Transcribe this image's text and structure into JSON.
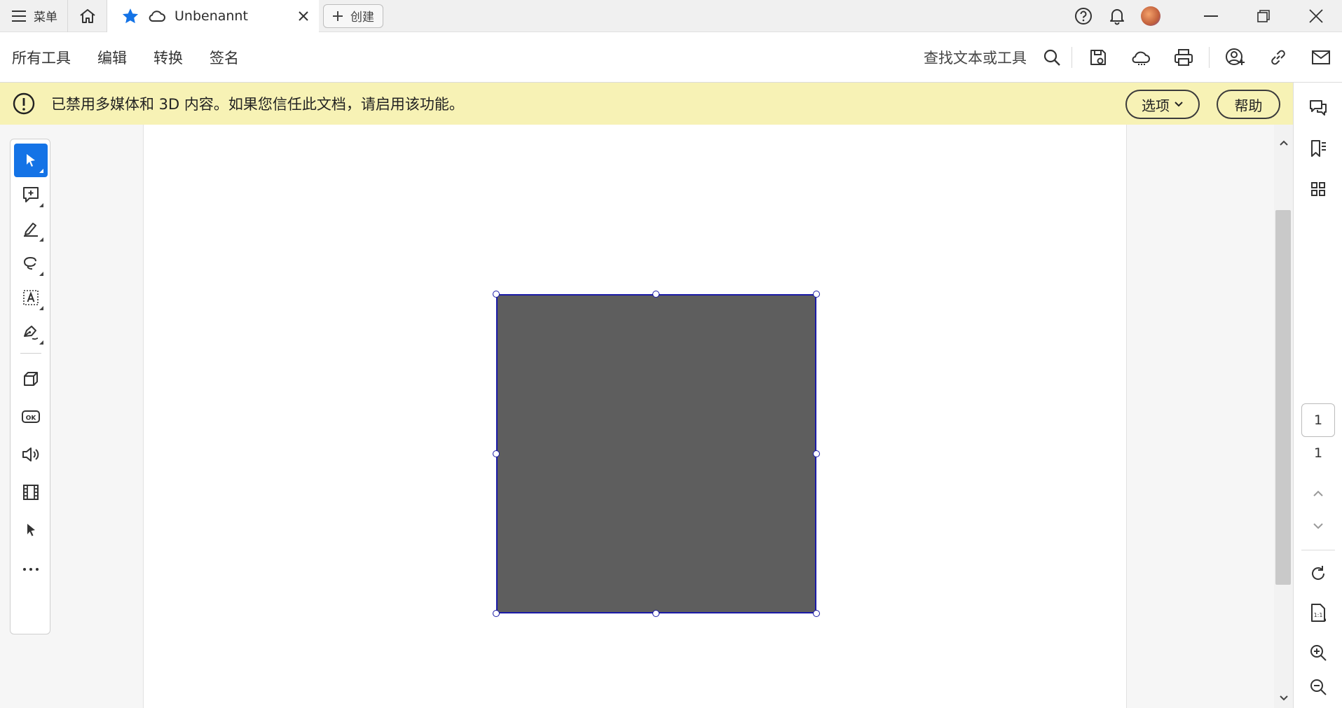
{
  "titlebar": {
    "menu_label": "菜单",
    "tab_title": "Unbenannt",
    "create_label": "创建"
  },
  "toolbar": {
    "items": [
      "所有工具",
      "编辑",
      "转换",
      "签名"
    ],
    "search_label": "查找文本或工具"
  },
  "notice": {
    "message": "已禁用多媒体和 3D 内容。如果您信任此文档，请启用该功能。",
    "options_label": "选项",
    "help_label": "帮助"
  },
  "page_nav": {
    "current_page": "1",
    "total_pages": "1"
  },
  "colors": {
    "accent": "#1473e6",
    "notice_bg": "#f7f2b5",
    "shape_fill": "#5e5e5e",
    "selection": "#1a1aa6"
  }
}
